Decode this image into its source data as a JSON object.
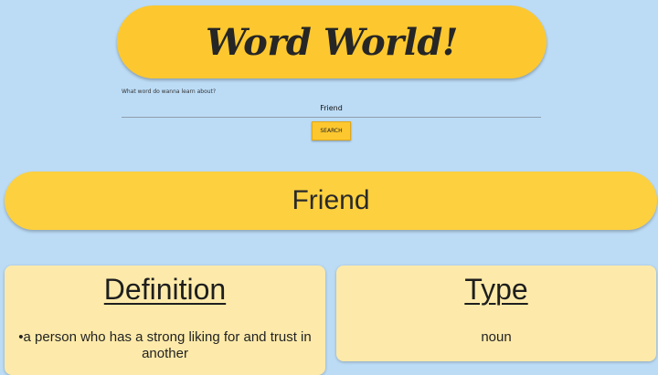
{
  "header": {
    "title": "Word World!"
  },
  "search": {
    "prompt": "What word do wanna learn about?",
    "value": "Friend",
    "button_label": "SEARCH"
  },
  "result": {
    "word": "Friend",
    "definition": {
      "heading": "Definition",
      "text": "•a person who has a strong liking for and trust in another"
    },
    "type": {
      "heading": "Type",
      "text": "noun"
    }
  },
  "colors": {
    "background": "#bcdcf6",
    "accent_yellow": "#fdc82f",
    "card_cream": "#fdeaaa"
  }
}
